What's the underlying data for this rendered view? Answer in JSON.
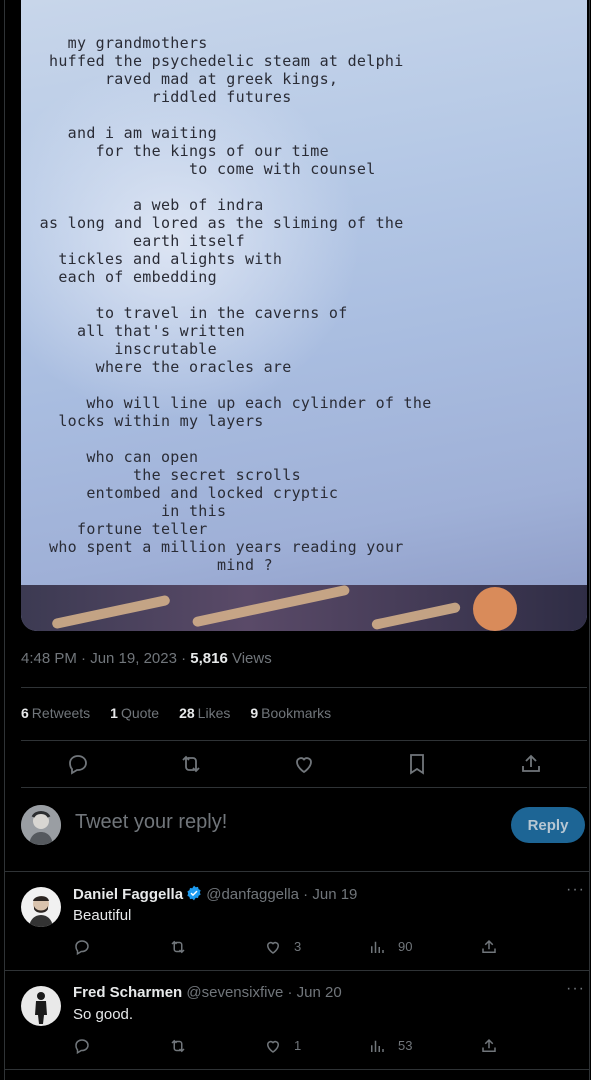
{
  "poem_lines": [
    "     my grandmothers",
    "   huffed the psychedelic steam at delphi",
    "         raved mad at greek kings,",
    "              riddled futures",
    "",
    "     and i am waiting",
    "        for the kings of our time",
    "                  to come with counsel",
    "",
    "            a web of indra",
    "  as long and lored as the sliming of the",
    "            earth itself",
    "    tickles and alights with",
    "    each of embedding",
    "",
    "        to travel in the caverns of",
    "      all that's written",
    "          inscrutable",
    "        where the oracles are",
    "",
    "       who will line up each cylinder of the",
    "    locks within my layers",
    "",
    "       who can open",
    "            the secret scrolls",
    "       entombed and locked cryptic",
    "               in this",
    "      fortune teller",
    "   who spent a million years reading your",
    "                     mind ?"
  ],
  "tweet": {
    "time": "4:48 PM · Jun 19, 2023 · ",
    "views_count": "5,816",
    "views_label": " Views",
    "retweets_count": "6",
    "retweets_label": "Retweets",
    "quotes_count": "1",
    "quotes_label": "Quote",
    "likes_count": "28",
    "likes_label": "Likes",
    "bookmarks_count": "9",
    "bookmarks_label": "Bookmarks"
  },
  "reply_box": {
    "placeholder": "Tweet your reply!",
    "button_label": "Reply"
  },
  "replies": [
    {
      "name": "Daniel Faggella",
      "handle": "@danfaggella · Jun 19",
      "text": "Beautiful",
      "more": "···",
      "likes": "3",
      "views": "90",
      "verified": true
    },
    {
      "name": "Fred Scharmen",
      "handle": "@sevensixfive · Jun 20",
      "text": "So good.",
      "more": "···",
      "likes": "1",
      "views": "53",
      "verified": false
    }
  ],
  "colors": {
    "background": "#000000",
    "text": "#e7e9ea",
    "muted": "#71767b",
    "border": "#2f3336",
    "reply_button": "#1d6595",
    "verified": "#1d9bf0"
  }
}
